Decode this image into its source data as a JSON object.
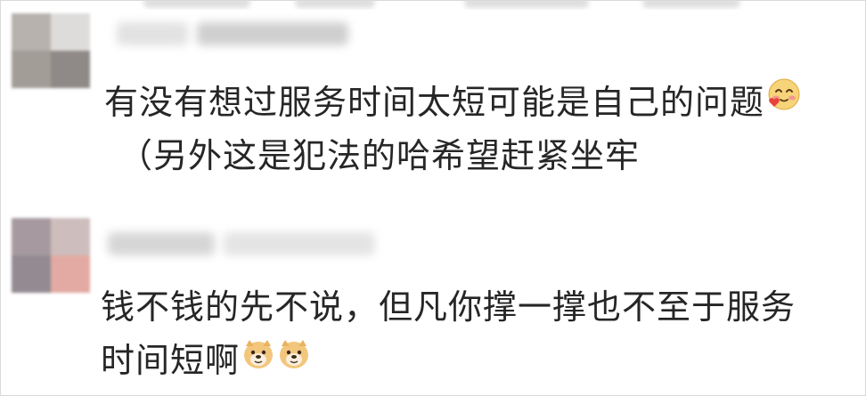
{
  "comments": [
    {
      "text_line1": "有没有想过服务时间太短可能是自己的问题",
      "text_line2": "（另外这是犯法的哈希望赶紧坐牢",
      "emojis": [
        "blush-heart-emoji"
      ],
      "avatar_colors": [
        "#b7b2ad",
        "#dcdcdc",
        "#a6a09a",
        "#8f8a87"
      ]
    },
    {
      "text_line1": "钱不钱的先不说，但凡你撑一撑也不至于服务",
      "text_line2": "时间短啊",
      "emojis": [
        "doge-emoji",
        "doge-emoji"
      ],
      "avatar_colors": [
        "#a69aa0",
        "#c9b9b8",
        "#938a92",
        "#e3a9a2"
      ]
    }
  ]
}
